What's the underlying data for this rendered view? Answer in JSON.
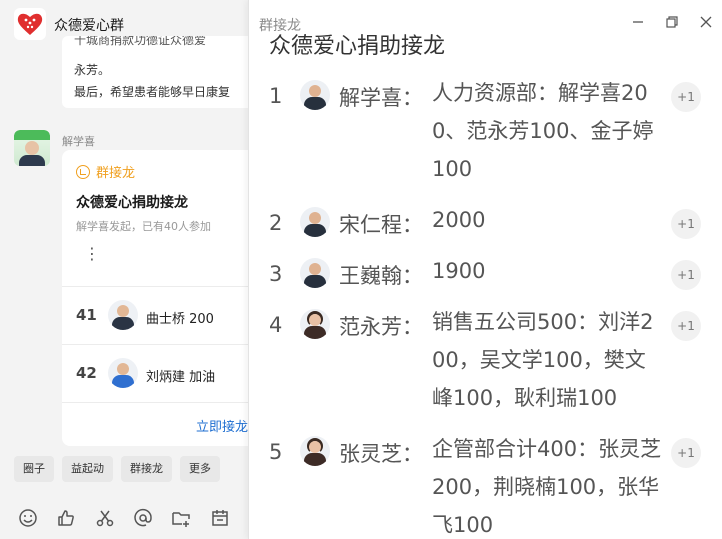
{
  "chat": {
    "group_title": "众德爱心群",
    "prev_message": {
      "line1": "十城商捐款功德证众德爱",
      "line2": "永芳。",
      "line3": "最后，希望患者能够早日康复"
    },
    "sender_name": "解学喜",
    "card": {
      "tag": "群接龙",
      "title": "众德爱心捐助接龙",
      "subtitle": "解学喜发起，已有40人参加",
      "more": "⋮",
      "rows": [
        {
          "num": "41",
          "text": "曲士桥 200"
        },
        {
          "num": "42",
          "text": "刘炳建 加油"
        }
      ],
      "action": "立即接龙"
    },
    "quick_actions": [
      "圈子",
      "益起动",
      "群接龙",
      "更多"
    ],
    "tools": [
      "emoji-icon",
      "thumbs-up-icon",
      "scissors-icon",
      "mention-icon",
      "folder-add-icon",
      "calendar-icon"
    ]
  },
  "panel": {
    "title": "群接龙",
    "heading": "众德爱心捐助接龙",
    "entries": [
      {
        "idx": "1",
        "name": "解学喜：",
        "content": "人力资源部：解学喜200、范永芳100、金子婷100",
        "plus": "+1"
      },
      {
        "idx": "2",
        "name": "宋仁程：",
        "content": "2000",
        "plus": "+1"
      },
      {
        "idx": "3",
        "name": "王巍翰：",
        "content": "1900",
        "plus": "+1"
      },
      {
        "idx": "4",
        "name": "范永芳：",
        "content": "销售五公司500：刘洋200，吴文学100，樊文峰100，耿利瑞100",
        "plus": "+1"
      },
      {
        "idx": "5",
        "name": "张灵芝：",
        "content": "企管部合计400：张灵芝200，荆晓楠100，张华飞100",
        "plus": "+1"
      }
    ]
  }
}
